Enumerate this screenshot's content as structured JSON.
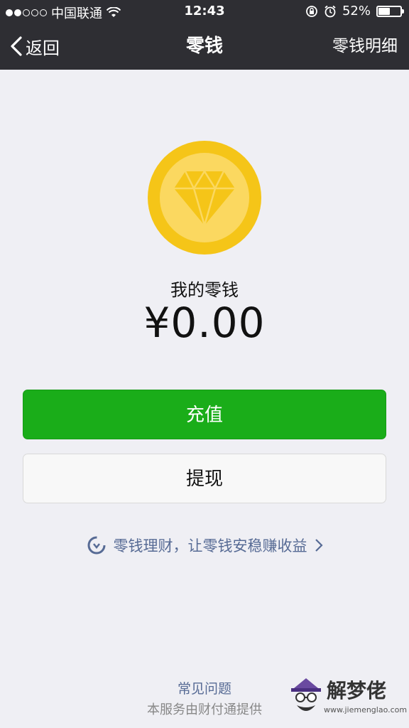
{
  "status_bar": {
    "carrier": "中国联通",
    "time": "12:43",
    "battery_percent": "52%",
    "battery_level": 0.52,
    "icons": [
      "signal-dots-icon",
      "wifi-icon",
      "rotation-lock-icon",
      "alarm-icon",
      "battery-icon"
    ]
  },
  "nav": {
    "back_label": "返回",
    "title": "零钱",
    "right_label": "零钱明细"
  },
  "wallet": {
    "label": "我的零钱",
    "balance": "¥0.00"
  },
  "buttons": {
    "recharge": "充值",
    "withdraw": "提现"
  },
  "promo": {
    "text": "零钱理财，让零钱安稳赚收益",
    "icon": "wealth-icon"
  },
  "footer": {
    "faq": "常见问题",
    "provider": "本服务由财付通提供"
  },
  "watermark": {
    "brand": "解梦佬",
    "url": "www.jiemenglao.com"
  },
  "colors": {
    "header_bg": "#2e2e33",
    "page_bg": "#efeff4",
    "primary_green": "#1aad19",
    "link_blue": "#576b95",
    "coin_outer": "#f5c518",
    "coin_inner": "#fbd860"
  }
}
